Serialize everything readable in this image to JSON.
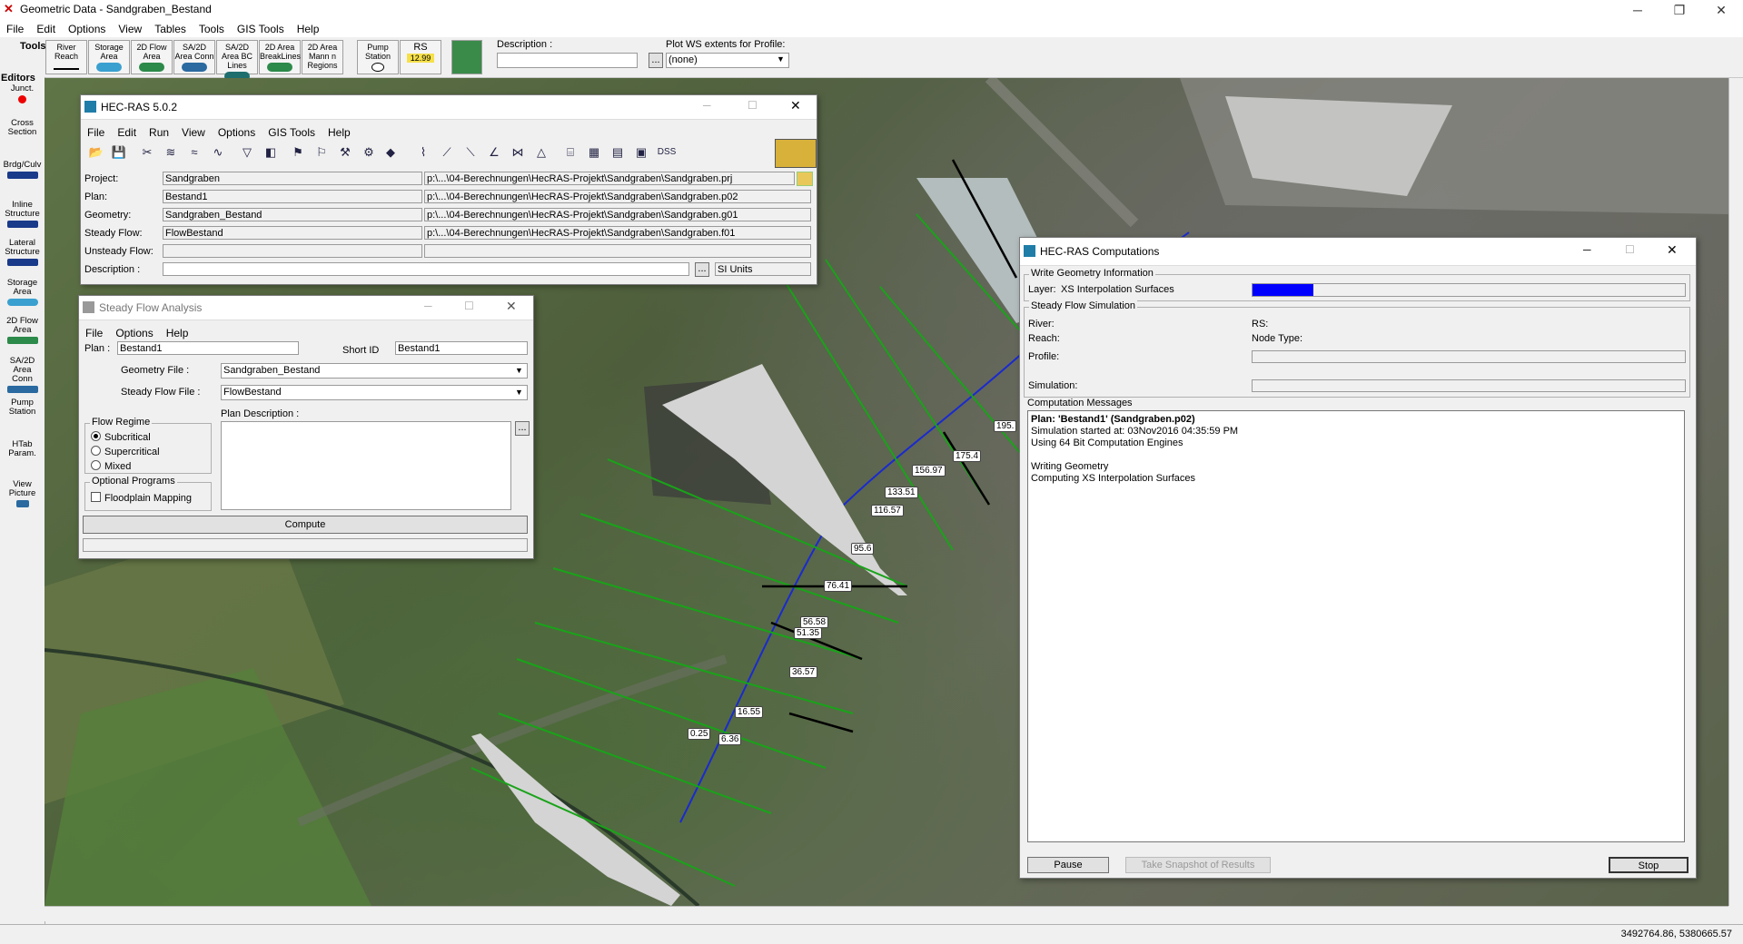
{
  "app": {
    "title": "Geometric Data - Sandgraben_Bestand",
    "menu": [
      "File",
      "Edit",
      "Options",
      "View",
      "Tables",
      "Tools",
      "GIS Tools",
      "Help"
    ]
  },
  "toolbar": {
    "tools_label": "Tools",
    "editors_label": "Editors",
    "buttons": [
      "River Reach",
      "Storage Area",
      "2D Flow Area",
      "SA/2D Area Conn",
      "SA/2D Area BC Lines",
      "2D Area BreakLines",
      "2D Area Mann n Regions",
      "Pump Station",
      "RS"
    ],
    "rs_value": "12.99",
    "description_label": "Description :",
    "description_value": "",
    "plot_ws_label": "Plot WS extents for Profile:",
    "plot_ws_value": "(none)"
  },
  "editors": [
    "Junct.",
    "Cross Section",
    "Brdg/Culv",
    "Inline Structure",
    "Lateral Structure",
    "Storage Area",
    "2D Flow Area",
    "SA/2D Area Conn",
    "Pump Station",
    "HTab Param.",
    "View Picture"
  ],
  "map": {
    "station_labels": [
      "195.",
      "175.4",
      "156.97",
      "133.51",
      "116.57",
      "95.6",
      "76.41",
      "56.58",
      "51.35",
      "36.57",
      "16.55",
      "6.36",
      "0.25"
    ]
  },
  "status": {
    "coordinates": "3492764.86, 5380665.57"
  },
  "hecras": {
    "title": "HEC-RAS 5.0.2",
    "menu": [
      "File",
      "Edit",
      "Run",
      "View",
      "Options",
      "GIS Tools",
      "Help"
    ],
    "dss_label": "DSS",
    "project_label": "Project:",
    "project_value": "Sandgraben",
    "project_path": "p:\\...\\04-Berechnungen\\HecRAS-Projekt\\Sandgraben\\Sandgraben.prj",
    "plan_label": "Plan:",
    "plan_value": "Bestand1",
    "plan_path": "p:\\...\\04-Berechnungen\\HecRAS-Projekt\\Sandgraben\\Sandgraben.p02",
    "geometry_label": "Geometry:",
    "geometry_value": "Sandgraben_Bestand",
    "geometry_path": "p:\\...\\04-Berechnungen\\HecRAS-Projekt\\Sandgraben\\Sandgraben.g01",
    "steady_label": "Steady Flow:",
    "steady_value": "FlowBestand",
    "steady_path": "p:\\...\\04-Berechnungen\\HecRAS-Projekt\\Sandgraben\\Sandgraben.f01",
    "unsteady_label": "Unsteady Flow:",
    "unsteady_value": "",
    "description_label": "Description :",
    "units": "SI Units"
  },
  "steady": {
    "title": "Steady Flow Analysis",
    "menu": [
      "File",
      "Options",
      "Help"
    ],
    "plan_label": "Plan :",
    "plan_value": "Bestand1",
    "short_id_label": "Short ID",
    "short_id_value": "Bestand1",
    "geometry_file_label": "Geometry File :",
    "geometry_file_value": "Sandgraben_Bestand",
    "steady_file_label": "Steady Flow File :",
    "steady_file_value": "FlowBestand",
    "flow_regime_label": "Flow Regime",
    "regimes": [
      "Subcritical",
      "Supercritical",
      "Mixed"
    ],
    "selected_regime": "Subcritical",
    "plan_description_label": "Plan Description :",
    "optional_label": "Optional Programs",
    "floodplain_label": "Floodplain Mapping",
    "compute_label": "Compute"
  },
  "comp": {
    "title": "HEC-RAS Computations",
    "write_geom_label": "Write Geometry Information",
    "layer_label": "Layer:",
    "layer_value": "XS Interpolation Surfaces",
    "layer_progress": 0.14,
    "steady_sim_label": "Steady Flow Simulation",
    "river_label": "River:",
    "rs_label": "RS:",
    "reach_label": "Reach:",
    "node_type_label": "Node Type:",
    "profile_label": "Profile:",
    "simulation_label": "Simulation:",
    "messages_label": "Computation Messages",
    "messages": [
      "Plan: 'Bestand1' (Sandgraben.p02)",
      "Simulation started at: 03Nov2016 04:35:59 PM",
      "Using 64 Bit Computation Engines",
      "",
      "Writing Geometry",
      "Computing XS Interpolation Surfaces"
    ],
    "pause_label": "Pause",
    "snapshot_label": "Take Snapshot of Results",
    "stop_label": "Stop"
  }
}
